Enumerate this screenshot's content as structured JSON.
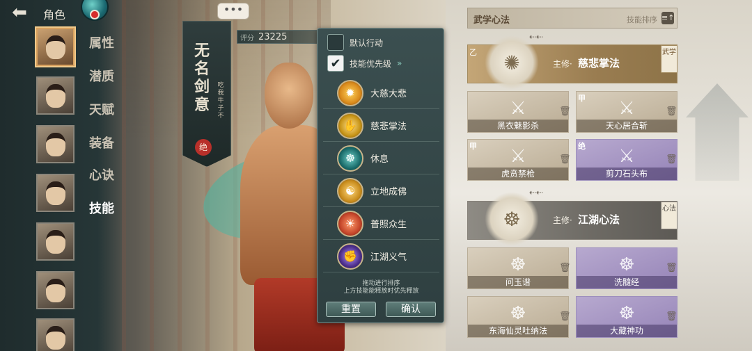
{
  "top_bar": {
    "back_icon": "back-arrow-icon",
    "title": "角色"
  },
  "nav": {
    "tabs": [
      "属性",
      "潜质",
      "天赋",
      "装备",
      "心诀",
      "技能"
    ],
    "active_tab": "技能"
  },
  "character": {
    "name": "无名剑意",
    "subtitle": "吃我牛子不",
    "rank_badge": "绝",
    "score_label": "评分",
    "score_value": "23225",
    "chat_icon": "•••"
  },
  "popup": {
    "options": [
      {
        "label": "默认行动",
        "checked": false
      },
      {
        "label": "技能优先级",
        "checked": true,
        "arrow": "»"
      }
    ],
    "skills": [
      {
        "name": "大慈大悲",
        "icon": "sunburst-icon",
        "color": "#d98a1c"
      },
      {
        "name": "慈悲掌法",
        "icon": "palm-icon",
        "color": "#c79417"
      },
      {
        "name": "休息",
        "icon": "meditate-icon",
        "color": "#1a6b6a"
      },
      {
        "name": "立地成佛",
        "icon": "buddha-icon",
        "color": "#c98d1e"
      },
      {
        "name": "普照众生",
        "icon": "radiance-icon",
        "color": "#c4452a"
      },
      {
        "name": "江湖义气",
        "icon": "fist-icon",
        "color": "#4c2f8a"
      }
    ],
    "hint_line1": "拖动进行排序",
    "hint_line2": "上方技能能释放时优先释放",
    "reset_label": "重置",
    "confirm_label": "确认"
  },
  "right_panel": {
    "header_title": "武学心法",
    "sort_label": "技能排序",
    "sort_icon": "≡↑",
    "martial_main": {
      "prefix": "主修·",
      "name": "慈悲掌法",
      "tag": "武学",
      "corner": "乙"
    },
    "martial_skills": [
      {
        "name": "黑衣魅影杀",
        "style": "tan",
        "grade": ""
      },
      {
        "name": "天心居合斩",
        "style": "tan",
        "grade": "甲"
      },
      {
        "name": "虎贲禁枪",
        "style": "tan",
        "grade": "甲"
      },
      {
        "name": "剪刀石头布",
        "style": "purple",
        "grade": "绝"
      }
    ],
    "mind_main": {
      "prefix": "主修·",
      "name": "江湖心法",
      "tag": "心法"
    },
    "mind_skills": [
      {
        "name": "问玉谱",
        "style": "tan"
      },
      {
        "name": "洗髓经",
        "style": "purple"
      },
      {
        "name": "东海仙灵吐纳法",
        "style": "tan"
      },
      {
        "name": "大藏神功",
        "style": "purple"
      }
    ]
  }
}
